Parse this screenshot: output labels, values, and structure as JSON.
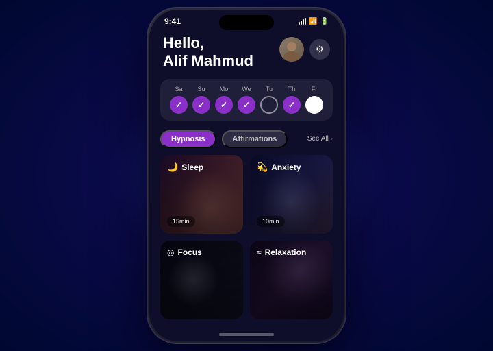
{
  "phone": {
    "status_bar": {
      "time": "9:41",
      "signal_label": "signal",
      "wifi_label": "wifi",
      "battery_label": "battery"
    },
    "header": {
      "greeting_line1": "Hello,",
      "greeting_line2": "Alif Mahmud",
      "avatar_emoji": "👤",
      "settings_icon": "⚙"
    },
    "days": {
      "items": [
        {
          "label": "Sa",
          "state": "completed"
        },
        {
          "label": "Su",
          "state": "completed"
        },
        {
          "label": "Mo",
          "state": "completed"
        },
        {
          "label": "We",
          "state": "completed"
        },
        {
          "label": "Tu",
          "state": "today"
        },
        {
          "label": "Th",
          "state": "completed"
        },
        {
          "label": "Fr",
          "state": "future"
        }
      ]
    },
    "tabs": {
      "active": "Hypnosis",
      "inactive": "Affirmations",
      "see_all": "See All",
      "see_all_arrow": "›"
    },
    "cards": [
      {
        "id": "sleep",
        "icon": "🌙",
        "title": "Sleep",
        "duration": "15min",
        "theme": "sleep"
      },
      {
        "id": "anxiety",
        "icon": "💫",
        "title": "Anxiety",
        "duration": "10min",
        "theme": "anxiety"
      },
      {
        "id": "focus",
        "icon": "◎",
        "title": "Focus",
        "duration": null,
        "theme": "focus"
      },
      {
        "id": "relaxation",
        "icon": "≈",
        "title": "Relaxation",
        "duration": null,
        "theme": "relaxation"
      }
    ]
  }
}
